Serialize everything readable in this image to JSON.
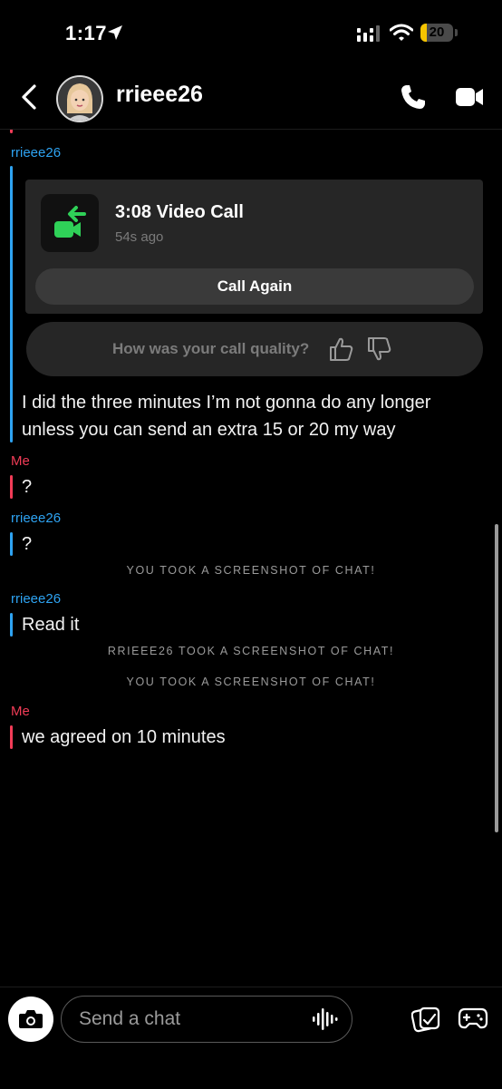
{
  "status": {
    "time": "1:17",
    "battery": "20",
    "battery_level": 0.2
  },
  "header": {
    "username": "rrieee26"
  },
  "messages": {
    "sender_them": "rrieee26",
    "sender_me": "Me",
    "call": {
      "title": "3:08 Video Call",
      "subtitle": "54s ago",
      "call_again": "Call Again",
      "quality_prompt": "How was your call quality?"
    },
    "m1": "I did the three minutes I’m not gonna do any longer",
    "m1b": "unless you can send an extra 15 or 20 my way",
    "m2": "?",
    "m3": "?",
    "sys1": "YOU TOOK A SCREENSHOT OF CHAT!",
    "m4": "Read it",
    "sys2": "RRIEEE26 TOOK A SCREENSHOT OF CHAT!",
    "sys3": "YOU TOOK A SCREENSHOT OF CHAT!",
    "m5": "we agreed on 10 minutes"
  },
  "composer": {
    "placeholder": "Send a chat"
  },
  "colors": {
    "them": "#2ea3f2",
    "me": "#f23c57",
    "call_green": "#2fd158",
    "battery": "#f5c400"
  }
}
